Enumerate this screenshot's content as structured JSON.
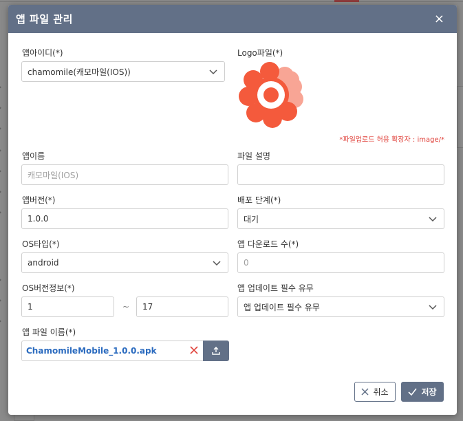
{
  "modal": {
    "title": "앱 파일 관리",
    "close_label": "×"
  },
  "form": {
    "app_id": {
      "label": "앱아이디(*)",
      "value": "chamomile(캐모마일(IOS))"
    },
    "logo": {
      "label": "Logo파일(*)",
      "hint": "*파일업로드 허용 확장자 : image/*"
    },
    "app_name": {
      "label": "앱이름",
      "value": "캐모마일(IOS)"
    },
    "file_desc": {
      "label": "파일 설명",
      "value": ""
    },
    "app_version": {
      "label": "앱버전(*)",
      "value": "1.0.0"
    },
    "deploy_stage": {
      "label": "배포 단계(*)",
      "value": "대기"
    },
    "os_type": {
      "label": "OS타입(*)",
      "value": "android"
    },
    "download_count": {
      "label": "앱 다운로드 수(*)",
      "value": "0"
    },
    "os_version": {
      "label": "OS버전정보(*)",
      "min": "1",
      "separator": "~",
      "max": "17"
    },
    "update_required": {
      "label": "앱 업데이트 필수 유무",
      "value": "앱 업데이트 필수 유무"
    },
    "app_file": {
      "label": "앱 파일 이름(*)",
      "value": "ChamomileMobile_1.0.0.apk"
    }
  },
  "actions": {
    "cancel_label": "취소",
    "save_label": "저장"
  },
  "colors": {
    "header": "#627087",
    "logo_primary": "#f45a3c",
    "logo_secondary": "#f8a595",
    "hint": "#e0413a",
    "link": "#2b6bbf"
  },
  "icons": {
    "close": "close-icon",
    "chevron": "chevron-down-icon",
    "clear": "clear-icon",
    "upload": "upload-icon",
    "cancel": "x-icon",
    "save": "check-icon"
  }
}
